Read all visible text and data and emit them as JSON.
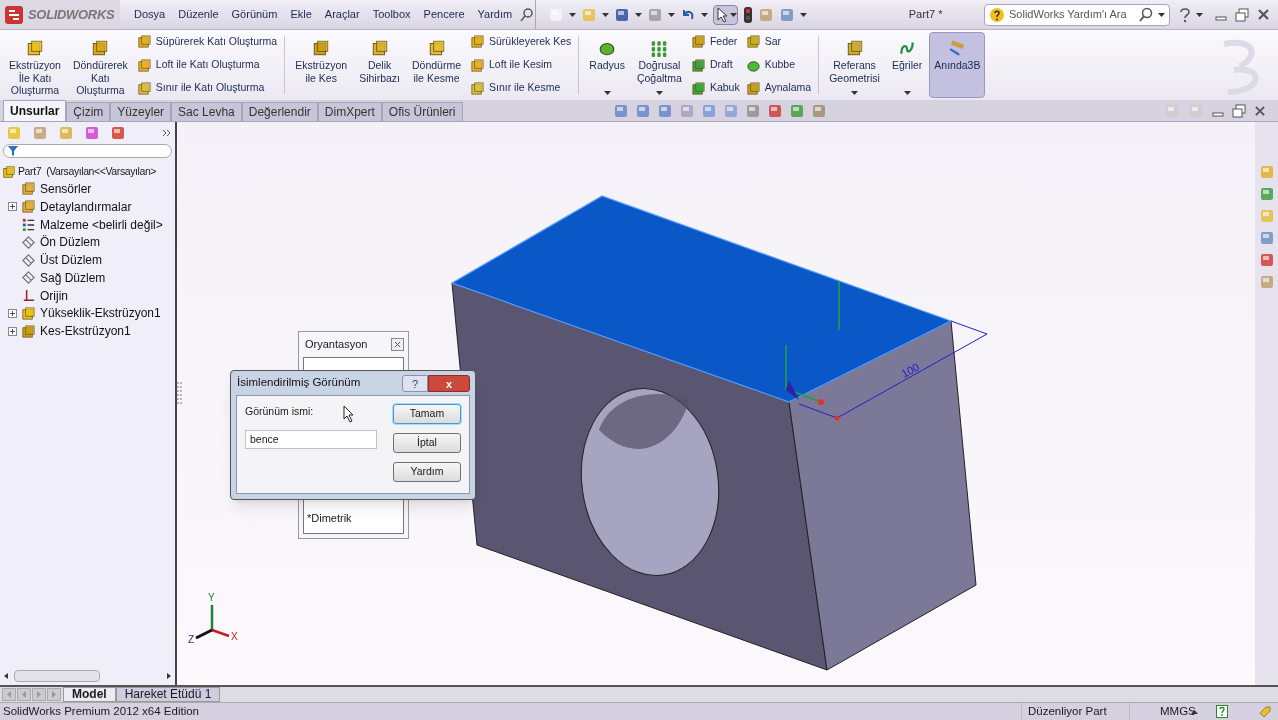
{
  "title_bar": {
    "logo": "SOLIDWORKS",
    "menu": [
      "Dosya",
      "Düzenle",
      "Görünüm",
      "Ekle",
      "Araçlar",
      "Toolbox",
      "Pencere",
      "Yardım"
    ],
    "document_title": "Part7 *",
    "search": {
      "placeholder": "SolidWorks Yardım'ı Ara"
    }
  },
  "ribbon": {
    "items": [
      {
        "kind": "large",
        "lines": [
          "Ekstrüzyon",
          "İle Katı",
          "Oluşturma"
        ],
        "dropdown": false,
        "pressed": false
      },
      {
        "kind": "large",
        "lines": [
          "Döndürerek",
          "Katı",
          "Oluşturma"
        ],
        "dropdown": false,
        "pressed": false
      },
      {
        "kind": "column",
        "items": [
          "Süpürerek Katı Oluşturma",
          "Loft ile Katı Oluşturma",
          "Sınır ile Katı Oluşturma"
        ]
      },
      {
        "kind": "separator"
      },
      {
        "kind": "large",
        "lines": [
          "Ekstrüzyon",
          "ile Kes"
        ],
        "dropdown": false,
        "pressed": false
      },
      {
        "kind": "large",
        "lines": [
          "Delik",
          "Sihirbazı"
        ],
        "dropdown": false,
        "pressed": false
      },
      {
        "kind": "large",
        "lines": [
          "Döndürme",
          "ile Kesme"
        ],
        "dropdown": false,
        "pressed": false
      },
      {
        "kind": "column",
        "items": [
          "Sürükleyerek Kes",
          "Loft ile Kesim",
          "Sınır ile Kesme"
        ]
      },
      {
        "kind": "separator"
      },
      {
        "kind": "large",
        "lines": [
          "Radyus"
        ],
        "dropdown": true,
        "pressed": false
      },
      {
        "kind": "large",
        "lines": [
          "Doğrusal",
          "Çoğaltma"
        ],
        "dropdown": true,
        "pressed": false
      },
      {
        "kind": "column",
        "items": [
          "Feder",
          "Draft",
          "Kabuk"
        ]
      },
      {
        "kind": "column",
        "items": [
          "Sar",
          "Kubbe",
          "Aynalama"
        ]
      },
      {
        "kind": "separator"
      },
      {
        "kind": "large",
        "lines": [
          "Referans",
          "Geometrisi"
        ],
        "dropdown": true,
        "pressed": false
      },
      {
        "kind": "large",
        "lines": [
          "Eğriler"
        ],
        "dropdown": true,
        "pressed": false
      },
      {
        "kind": "large",
        "lines": [
          "Anında3B"
        ],
        "dropdown": false,
        "pressed": true
      }
    ]
  },
  "tabs": [
    {
      "label": "Unsurlar",
      "selected": true
    },
    {
      "label": "Çizim",
      "selected": false
    },
    {
      "label": "Yüzeyler",
      "selected": false
    },
    {
      "label": "Sac Levha",
      "selected": false
    },
    {
      "label": "Değerlendir",
      "selected": false
    },
    {
      "label": "DimXpert",
      "selected": false
    },
    {
      "label": "Ofis Ürünleri",
      "selected": false
    }
  ],
  "tree": {
    "root": {
      "label": "Part7  (Varsayılan<<Varsayılan>",
      "children": [
        {
          "label": "Sensörler",
          "expandable": false
        },
        {
          "label": "Detaylandırmalar",
          "expandable": true
        },
        {
          "label": "Malzeme <belirli değil>",
          "expandable": false
        },
        {
          "label": "Ön Düzlem",
          "expandable": false
        },
        {
          "label": "Üst Düzlem",
          "expandable": false
        },
        {
          "label": "Sağ Düzlem",
          "expandable": false
        },
        {
          "label": "Orijin",
          "expandable": false
        },
        {
          "label": "Yükseklik-Ekstrüzyon1",
          "expandable": true
        },
        {
          "label": "Kes-Ekstrüzyon1",
          "expandable": true
        }
      ]
    }
  },
  "viewport": {
    "dimension": "100",
    "triad": {
      "x": "X",
      "y": "Y",
      "z": "Z"
    },
    "orientation_panel": {
      "title": "Oryantasyon",
      "item": "*Dimetrik"
    },
    "dialog": {
      "title": "İsimlendirilmiş Görünüm",
      "help": "?",
      "close": "x",
      "field_label": "Görünüm ismi:",
      "value": "bence",
      "buttons": [
        {
          "label": "Tamam",
          "default": true
        },
        {
          "label": "İptal",
          "default": false
        },
        {
          "label": "Yardım",
          "default": false
        }
      ]
    }
  },
  "bottom_tabs": [
    {
      "label": "Model",
      "selected": true
    },
    {
      "label": "Hareket Etüdü 1",
      "selected": false
    }
  ],
  "status_bar": {
    "edition": "SolidWorks Premium 2012 x64 Edition",
    "mode": "Düzenliyor Part",
    "units": "MMGS"
  }
}
